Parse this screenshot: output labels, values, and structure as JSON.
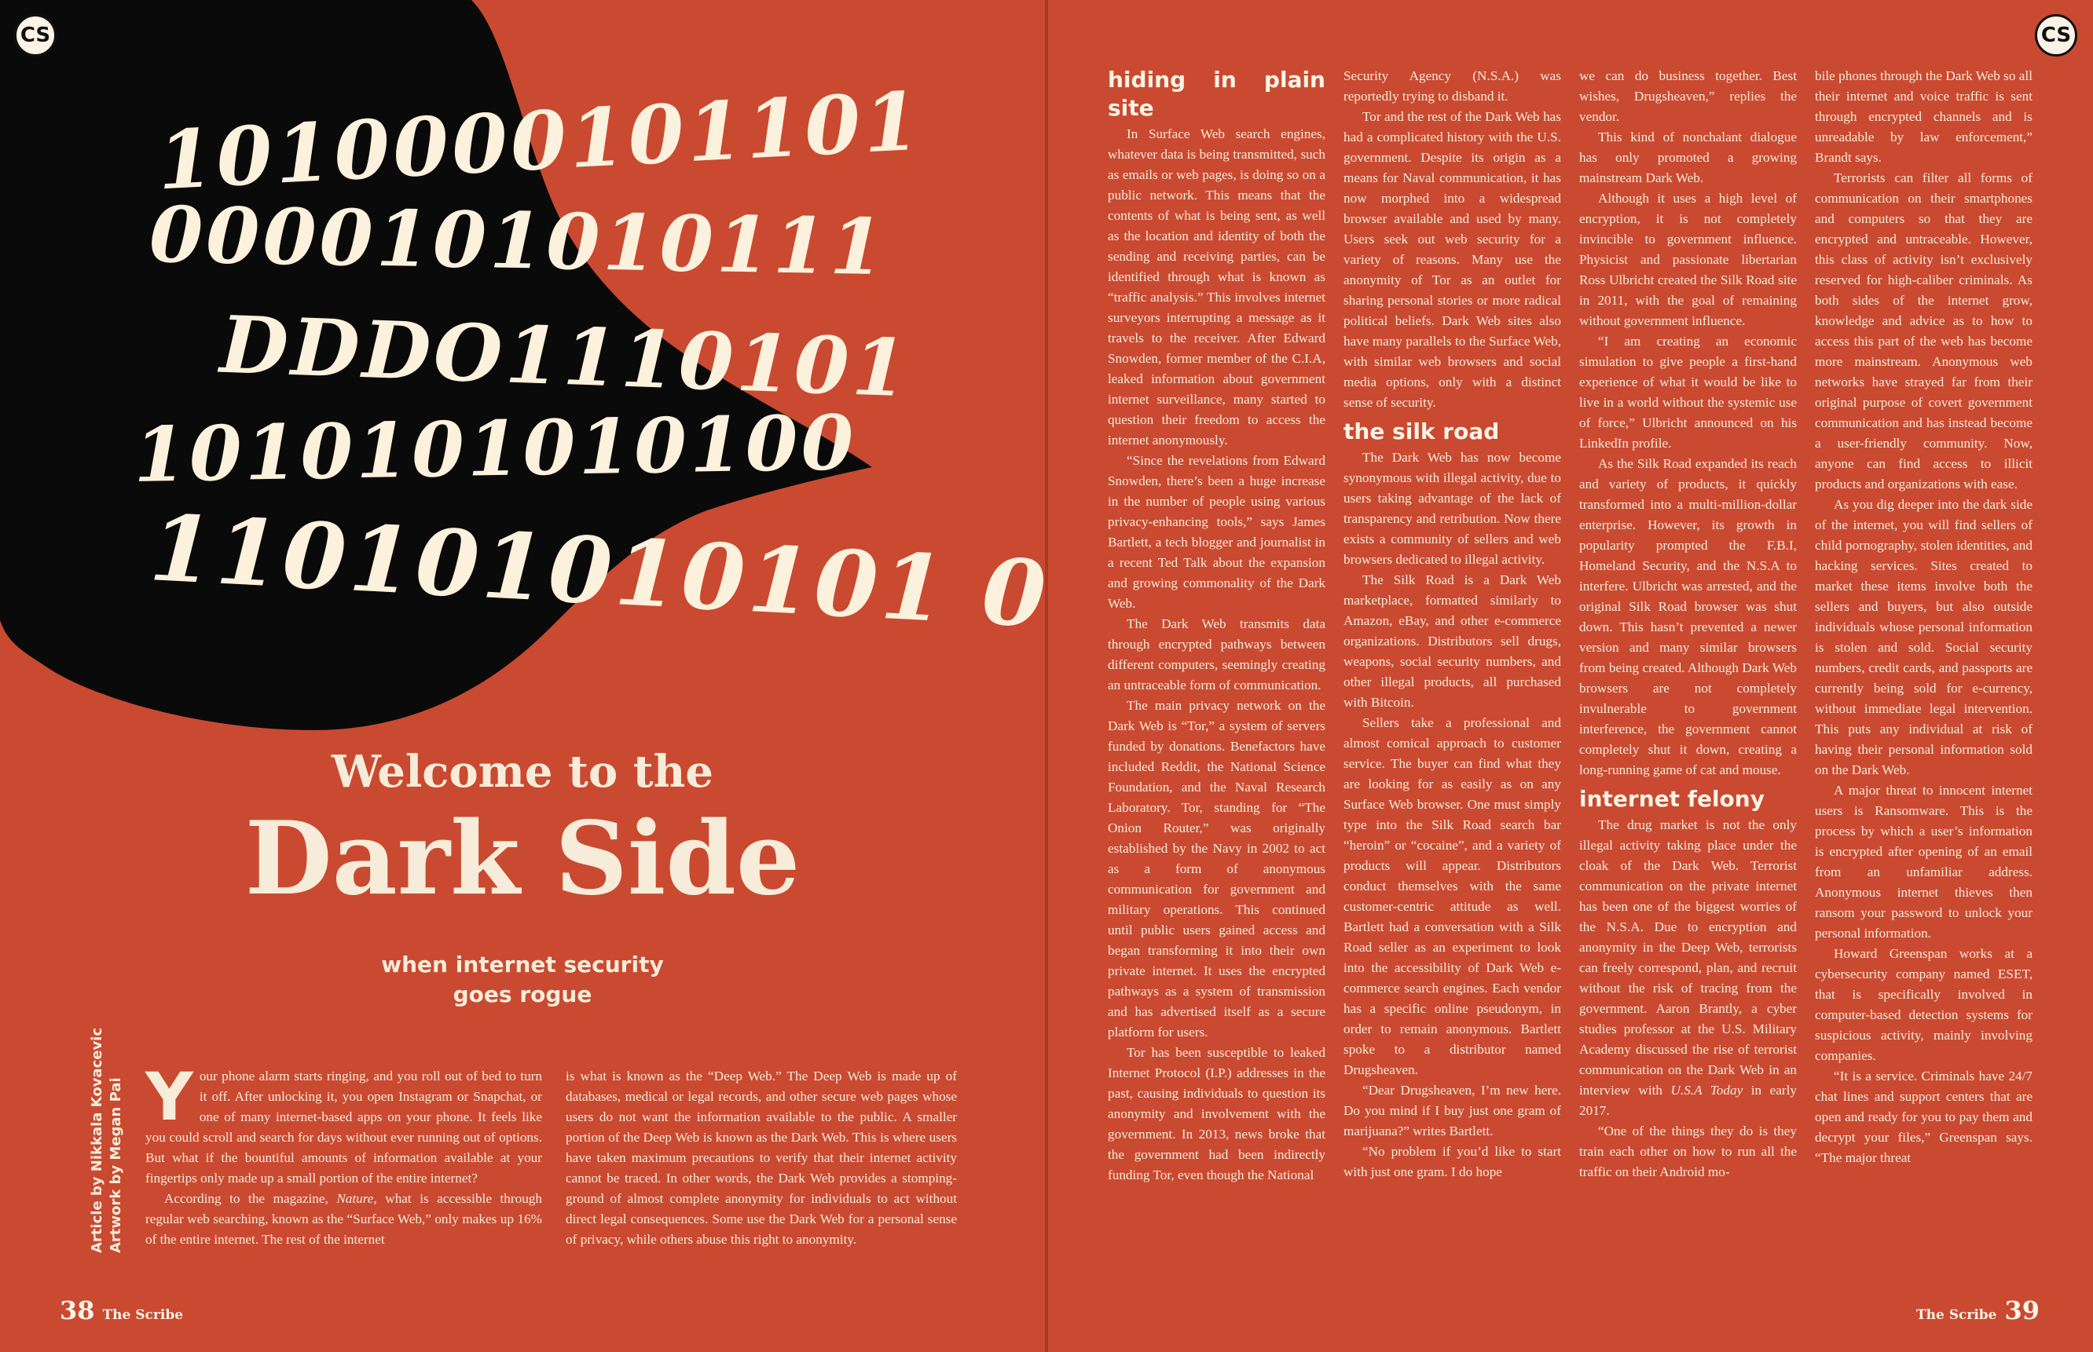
{
  "logo": {
    "text": "CS"
  },
  "binary": {
    "lines": [
      "1010000101101",
      "0000101010111",
      "DDDO1110101",
      "1010101010100",
      "110101010101 0"
    ]
  },
  "feature": {
    "title_small": "Welcome to the",
    "title_big": "Dark Side",
    "subtitle_1": "when internet security",
    "subtitle_2": "goes rogue",
    "credit_article": "Article by Nikkala Kovacevic",
    "credit_artwork": "Artwork by Megan Pai"
  },
  "left_text": {
    "dropcap": "Y",
    "col1_p1": "our phone alarm starts ringing, and you roll out of bed to turn it off. After unlocking it, you open Instagram or Snapchat, or one of many internet-based apps on your phone. It feels like you could scroll and search for days without ever running out of options. But what if the bountiful amounts of information available at your fingertips only made up a small portion of the entire internet?",
    "col1_p2_a": "According to the magazine, ",
    "col1_p2_em": "Nature",
    "col1_p2_b": ", what is accessible through regular web searching, known as the “Surface Web,” only makes up 16% of the entire internet. The rest of the internet",
    "col2_p1": "is what is known as the “Deep Web.” The Deep Web is made up of databases, medical or legal records, and other secure web pages whose users do not want the information available to the public. A smaller portion of the Deep Web is known as the Dark Web. This is where users have taken maximum precautions to verify that their internet activity cannot be traced. In other words, the Dark Web provides a stomping-ground of almost complete anonymity for individuals to act without direct legal consequences. Some use the Dark Web for a personal sense of privacy, while others abuse this right to anonymity."
  },
  "right_text": {
    "h_hiding": "hiding in plain site",
    "c1_p1": "In Surface Web search engines, whatever data is being transmitted, such as emails or web pages, is doing so on a public network. This means that the contents of what is being sent, as well as the location and identity of both the sending and receiving parties, can be identified through what is known as “traffic analysis.” This involves internet surveyors interrupting a message as it travels to the receiver. After Edward Snowden, former member of the C.I.A, leaked information about government internet surveillance, many started to question their freedom to access the internet anonymously.",
    "c1_p2": "“Since the revelations from Edward Snowden, there’s been a huge increase in the number of people using various privacy-enhancing tools,” says James Bartlett, a tech blogger and journalist in a recent Ted Talk about the expansion and growing commonality of the Dark Web.",
    "c1_p3": "The Dark Web transmits data through encrypted pathways between different computers, seemingly creating an untraceable form of communication.",
    "c1_p4": "The main privacy network on the Dark Web is “Tor,” a system of servers funded by donations. Benefactors have included Reddit, the National Science Foundation, and the Naval Research Laboratory. Tor, standing for “The Onion Router,” was originally established by the Navy in 2002 to act as a form of anonymous communication for government and military operations. This continued until public users gained access and began transforming it into their own private internet. It uses the encrypted pathways as a system of transmission and has advertised itself as a secure platform for users.",
    "c1_p5": "Tor has been susceptible to leaked Internet Protocol (I.P.) addresses in the past, causing individuals to question its anonymity and involvement with the government. In 2013, news broke that the government had been indirectly funding Tor, even though the National",
    "c2_p1": "Security Agency (N.S.A.) was reportedly trying to disband it.",
    "c2_p2": "Tor and the rest of the Dark Web has had a complicated history with the U.S. government. Despite its origin as a means for Naval communication, it has now morphed into a widespread browser available and used by many. Users seek out web security for a variety of reasons. Many use the anonymity of Tor as an outlet for sharing personal stories or more radical political beliefs. Dark Web sites also have many parallels to the Surface Web, with similar web browsers and social media options, only with a distinct sense of security.",
    "h_silk": "the silk road",
    "c2_p3": "The Dark Web has now become synonymous with illegal activity, due to users taking advantage of the lack of transparency and retribution. Now there exists a community of sellers and web browsers dedicated to illegal activity.",
    "c2_p4": "The Silk Road is a Dark Web marketplace, formatted similarly to Amazon, eBay, and other e-commerce organizations. Distributors sell drugs, weapons, social security numbers, and other illegal products, all purchased with Bitcoin.",
    "c2_p5": "Sellers take a professional and almost comical approach to customer service. The buyer can find what they are looking for as easily as on any Surface Web browser. One must simply type into the Silk Road search bar “heroin” or “cocaine”, and a variety of products will appear. Distributors conduct themselves with the same customer-centric attitude as well. Bartlett had a conversation with a Silk Road seller as an experiment to look into the accessibility of Dark Web e-commerce search engines. Each vendor has a specific online pseudonym, in order to remain anonymous. Bartlett spoke to a distributor named Drugsheaven.",
    "c2_p6": "“Dear Drugsheaven, I’m new here. Do you mind if I buy just one gram of marijuana?” writes Bartlett.",
    "c2_p7": "“No problem if you’d like to start with just one gram. I do hope",
    "c3_p1": "we can do business together. Best wishes, Drugsheaven,” replies the vendor.",
    "c3_p2": "This kind of nonchalant dialogue has only promoted a growing mainstream Dark Web.",
    "c3_p3": "Although it uses a high level of encryption, it is not completely invincible to government influence. Physicist and passionate libertarian Ross Ulbricht created the Silk Road site in 2011, with the goal of remaining without government influence.",
    "c3_p4": "“I am creating an economic simulation to give people a first-hand experience of what it would be like to live in a world without the systemic use of force,” Ulbricht announced on his LinkedIn profile.",
    "c3_p5": "As the Silk Road expanded its reach and variety of products, it quickly transformed into a multi-million-dollar enterprise. However, its growth in popularity prompted the F.B.I, Homeland Security, and the N.S.A to interfere. Ulbricht was arrested, and the original Silk Road browser was shut down. This hasn’t prevented a newer version and many similar browsers from being created. Although Dark Web browsers are not completely invulnerable to government interference, the government cannot completely shut it down, creating a long-running game of cat and mouse.",
    "h_felony": "internet felony",
    "c3_p6_a": "The drug market is not the only illegal activity taking place under the cloak of the Dark Web. Terrorist communication on the private internet has been one of the biggest worries of the N.S.A. Due to encryption and anonymity in the Deep Web, terrorists can freely correspond, plan, and recruit without the risk of tracing from the government. Aaron Brantly, a cyber studies professor at the U.S. Military Academy discussed the rise of terrorist communication on the Dark Web in an interview with ",
    "c3_p6_em": "U.S.A Today",
    "c3_p6_b": " in early 2017.",
    "c3_p7": "“One of the things they do is they train each other on how to run all the traffic on their Android mo-",
    "c4_p1": "bile phones through the Dark Web so all their internet and voice traffic is sent through encrypted channels and is unreadable by law enforcement,” Brandt says.",
    "c4_p2": "Terrorists can filter all forms of communication on their smartphones and computers so that they are encrypted and untraceable. However, this class of activity isn’t exclusively reserved for high-caliber criminals. As both sides of the internet grow, knowledge and advice as to how to access this part of the web has become more mainstream. Anonymous web networks have strayed far from their original purpose of covert government communication and has instead become a user-friendly community. Now, anyone can find access to illicit products and organizations with ease.",
    "c4_p3": "As you dig deeper into the dark side of the internet, you will find sellers of child pornography, stolen identities, and hacking services. Sites created to market these items involve both the sellers and buyers, but also outside individuals whose personal information is stolen and sold. Social security numbers, credit cards, and passports are currently being sold for e-currency, without immediate legal intervention. This puts any individual at risk of having their personal information sold on the Dark Web.",
    "c4_p4": "A major threat to innocent internet users is Ransomware. This is the process by which a user’s information is encrypted after opening of an email from an unfamiliar address. Anonymous internet thieves  then ransom your password to unlock your personal information.",
    "c4_p5": "Howard Greenspan works at a cybersecurity company named ESET, that is specifically involved in computer-based detection systems for suspicious activity, mainly involving companies.",
    "c4_p6": "“It is a service. Criminals have 24/7 chat lines and support centers that are open and ready for you to pay them and decrypt your files,” Greenspan says. “The major threat"
  },
  "footer": {
    "left_page": "38",
    "right_page": "39",
    "publication": "The Scribe"
  },
  "colors": {
    "background": "#c94a31",
    "cream": "#f6ecd9",
    "black": "#0a0a0a"
  }
}
